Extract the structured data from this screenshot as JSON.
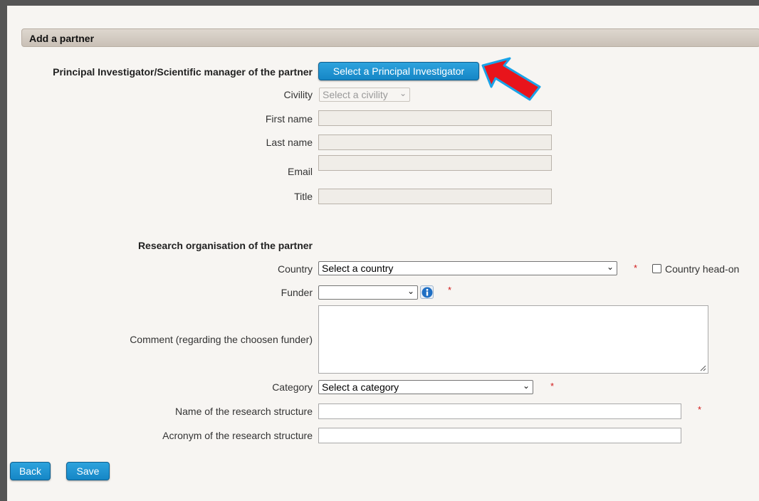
{
  "section": {
    "title": "Add a partner"
  },
  "pi": {
    "heading": "Principal Investigator/Scientific manager of the partner",
    "select_button": "Select a Principal Investigator",
    "civility_label": "Civility",
    "civility_placeholder": "Select a civility",
    "first_name_label": "First name",
    "first_name_value": "",
    "last_name_label": "Last name",
    "last_name_value": "",
    "email_label": "Email",
    "email_value": "",
    "title_label": "Title",
    "title_value": ""
  },
  "org": {
    "heading": "Research organisation of the partner",
    "country_label": "Country",
    "country_value": "Select a country",
    "country_head_on_label": "Country head-on",
    "funder_label": "Funder",
    "funder_value": "",
    "comment_label": "Comment (regarding the choosen funder)",
    "comment_value": "",
    "category_label": "Category",
    "category_value": "Select a category",
    "structure_name_label": "Name of the research structure",
    "structure_name_value": "",
    "structure_acronym_label": "Acronym of the research structure",
    "structure_acronym_value": ""
  },
  "required_mark": "*",
  "actions": {
    "back": "Back",
    "save": "Save"
  },
  "icons": {
    "annotation": "red-arrow-icon",
    "info": "info-icon",
    "dropdown": "chevron-down-icon"
  },
  "colors": {
    "button": "#1a8fd0",
    "required": "#d21a1a",
    "annotation_arrow": "#e8141b"
  }
}
